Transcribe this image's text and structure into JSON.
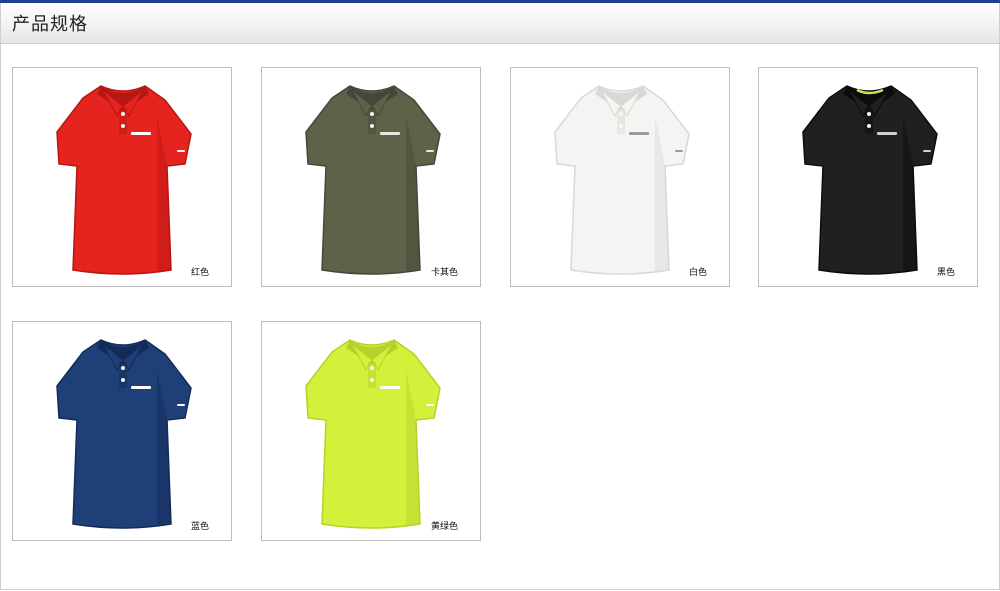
{
  "header": {
    "title": "产品规格"
  },
  "products": [
    {
      "label": "红色",
      "color": "#e5241f",
      "shade": "#b51712",
      "logo": "#ffffff"
    },
    {
      "label": "卡其色",
      "color": "#5f6248",
      "shade": "#45473a",
      "logo": "#e8e8e0"
    },
    {
      "label": "白色",
      "color": "#f4f4f2",
      "shade": "#d8d8d4",
      "logo": "#9a9a9a"
    },
    {
      "label": "黑色",
      "color": "#202020",
      "shade": "#0c0c0c",
      "logo": "#d0d0d0",
      "accent": "#c8e05a"
    },
    {
      "label": "蓝色",
      "color": "#1f3f78",
      "shade": "#142b57",
      "logo": "#ffffff"
    },
    {
      "label": "黄绿色",
      "color": "#d4f03a",
      "shade": "#b6d12a",
      "logo": "#ffffff"
    }
  ]
}
